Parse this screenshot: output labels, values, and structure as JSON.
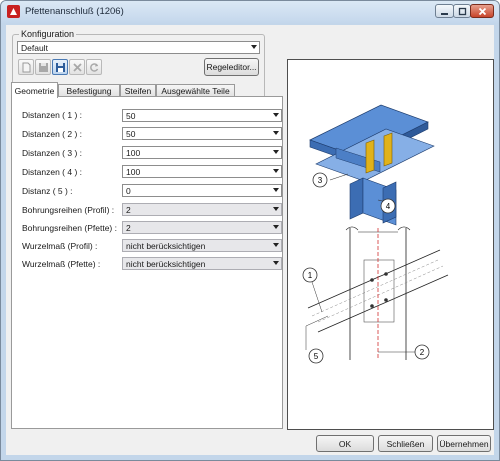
{
  "window": {
    "title": "Pfettenanschluß (1206)",
    "minimize_icon": "minimize-icon",
    "maximize_icon": "maximize-icon",
    "close_icon": "close-icon"
  },
  "config": {
    "group_label": "Konfiguration",
    "selected": "Default",
    "toolbar_icons": [
      "open-icon",
      "save-icon",
      "save-as-icon",
      "delete-icon",
      "refresh-icon"
    ],
    "rule_editor_label": "Regeleditor..."
  },
  "tabs": [
    "Geometrie",
    "Befestigung",
    "Steifen",
    "Ausgewählte Teile"
  ],
  "active_tab": "Geometrie",
  "fields": [
    {
      "label": "Distanzen ( 1 ) :",
      "value": "50",
      "type": "combo"
    },
    {
      "label": "Distanzen ( 2 ) :",
      "value": "50",
      "type": "combo"
    },
    {
      "label": "Distanzen ( 3 ) :",
      "value": "100",
      "type": "combo"
    },
    {
      "label": "Distanzen ( 4 ) :",
      "value": "100",
      "type": "combo"
    },
    {
      "label": "Distanz    ( 5 ) :",
      "value": "0",
      "type": "combo"
    },
    {
      "label": "Bohrungsreihen (Profil) :",
      "value": "2",
      "type": "dropdown"
    },
    {
      "label": "Bohrungsreihen (Pfette) :",
      "value": "2",
      "type": "dropdown"
    },
    {
      "label": "Wurzelmaß (Profil) :",
      "value": "nicht berücksichtigen",
      "type": "dropdown"
    },
    {
      "label": "Wurzelmaß (Pfette) :",
      "value": "nicht berücksichtigen",
      "type": "dropdown"
    }
  ],
  "preview": {
    "callouts": [
      "3",
      "4",
      "1",
      "2",
      "5"
    ]
  },
  "buttons": {
    "ok": "OK",
    "close": "Schließen",
    "apply": "Übernehmen"
  },
  "colors": {
    "beam_blue": "#5b8fd6",
    "plate_yellow": "#e0b21a",
    "axis_red": "#d23030",
    "titlebar": "#c4d7ec"
  }
}
